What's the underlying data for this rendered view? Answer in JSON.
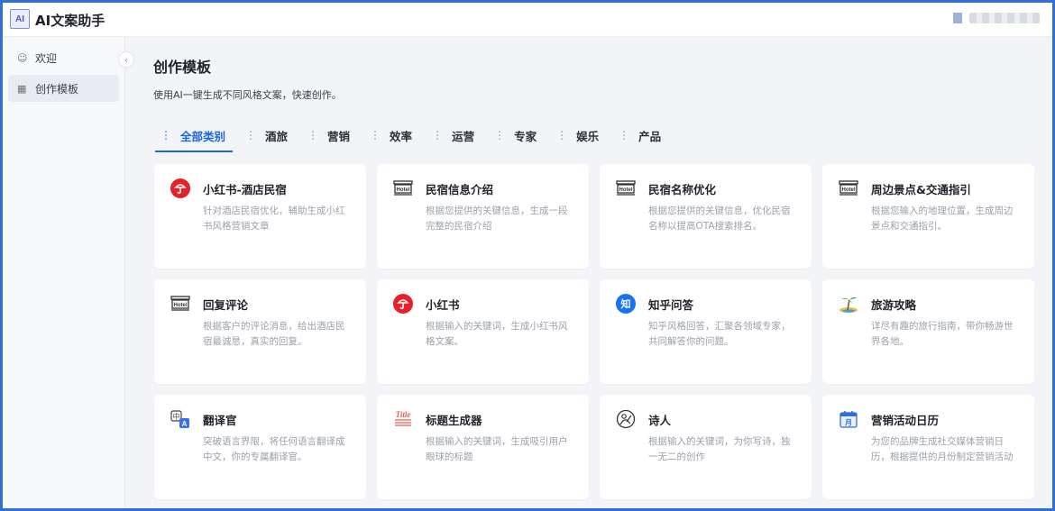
{
  "app": {
    "logo_text": "AI",
    "title": "AI文案助手"
  },
  "sidebar": {
    "items": [
      {
        "icon": "smile-icon",
        "label": "欢迎",
        "active": false
      },
      {
        "icon": "grid-icon",
        "label": "创作模板",
        "active": true
      }
    ]
  },
  "main": {
    "title": "创作模板",
    "description": "使用AI一键生成不同风格文案，快速创作。",
    "tabs": [
      {
        "label": "全部类别",
        "active": true
      },
      {
        "label": "酒旅",
        "active": false
      },
      {
        "label": "营销",
        "active": false
      },
      {
        "label": "效率",
        "active": false
      },
      {
        "label": "运营",
        "active": false
      },
      {
        "label": "专家",
        "active": false
      },
      {
        "label": "娱乐",
        "active": false
      },
      {
        "label": "产品",
        "active": false
      }
    ],
    "cards": [
      {
        "icon": "xiaohongshu-icon",
        "title": "小红书-酒店民宿",
        "desc": "针对酒店民宿优化，辅助生成小红书风格营销文章"
      },
      {
        "icon": "hotel-icon",
        "title": "民宿信息介绍",
        "desc": "根据您提供的关键信息，生成一段完整的民宿介绍"
      },
      {
        "icon": "hotel-icon",
        "title": "民宿名称优化",
        "desc": "根据您提供的关键信息，优化民宿名称以提高OTA搜索排名。"
      },
      {
        "icon": "hotel-icon",
        "title": "周边景点&交通指引",
        "desc": "根据您输入的地理位置，生成周边景点和交通指引。"
      },
      {
        "icon": "hotel-icon",
        "title": "回复评论",
        "desc": "根据客户的评论消息，给出酒店民宿最诚恳，真实的回复。"
      },
      {
        "icon": "xiaohongshu-icon",
        "title": "小红书",
        "desc": "根据输入的关键词，生成小红书风格文案。"
      },
      {
        "icon": "zhihu-icon",
        "title": "知乎问答",
        "desc": "知乎风格回答，汇聚各领域专家，共同解答你的问题。"
      },
      {
        "icon": "island-icon",
        "title": "旅游攻略",
        "desc": "详尽有趣的旅行指南，带你畅游世界各地。"
      },
      {
        "icon": "translate-icon",
        "title": "翻译官",
        "desc": "突破语言界限，将任何语言翻译成中文，你的专属翻译官。"
      },
      {
        "icon": "title-icon",
        "title": "标题生成器",
        "desc": "根据输入的关键词，生成吸引用户眼球的标题"
      },
      {
        "icon": "poet-icon",
        "title": "诗人",
        "desc": "根据输入的关键词，为你写诗，独一无二的创作"
      },
      {
        "icon": "calendar-icon",
        "title": "营销活动日历",
        "desc": "为您的品牌生成社交媒体营销日历，根据提供的月份制定营销活动"
      }
    ]
  },
  "colors": {
    "accent": "#1a66e0",
    "frame": "#2f6fd6",
    "xhs_red": "#e8202a",
    "zhihu_blue": "#1772f6"
  }
}
